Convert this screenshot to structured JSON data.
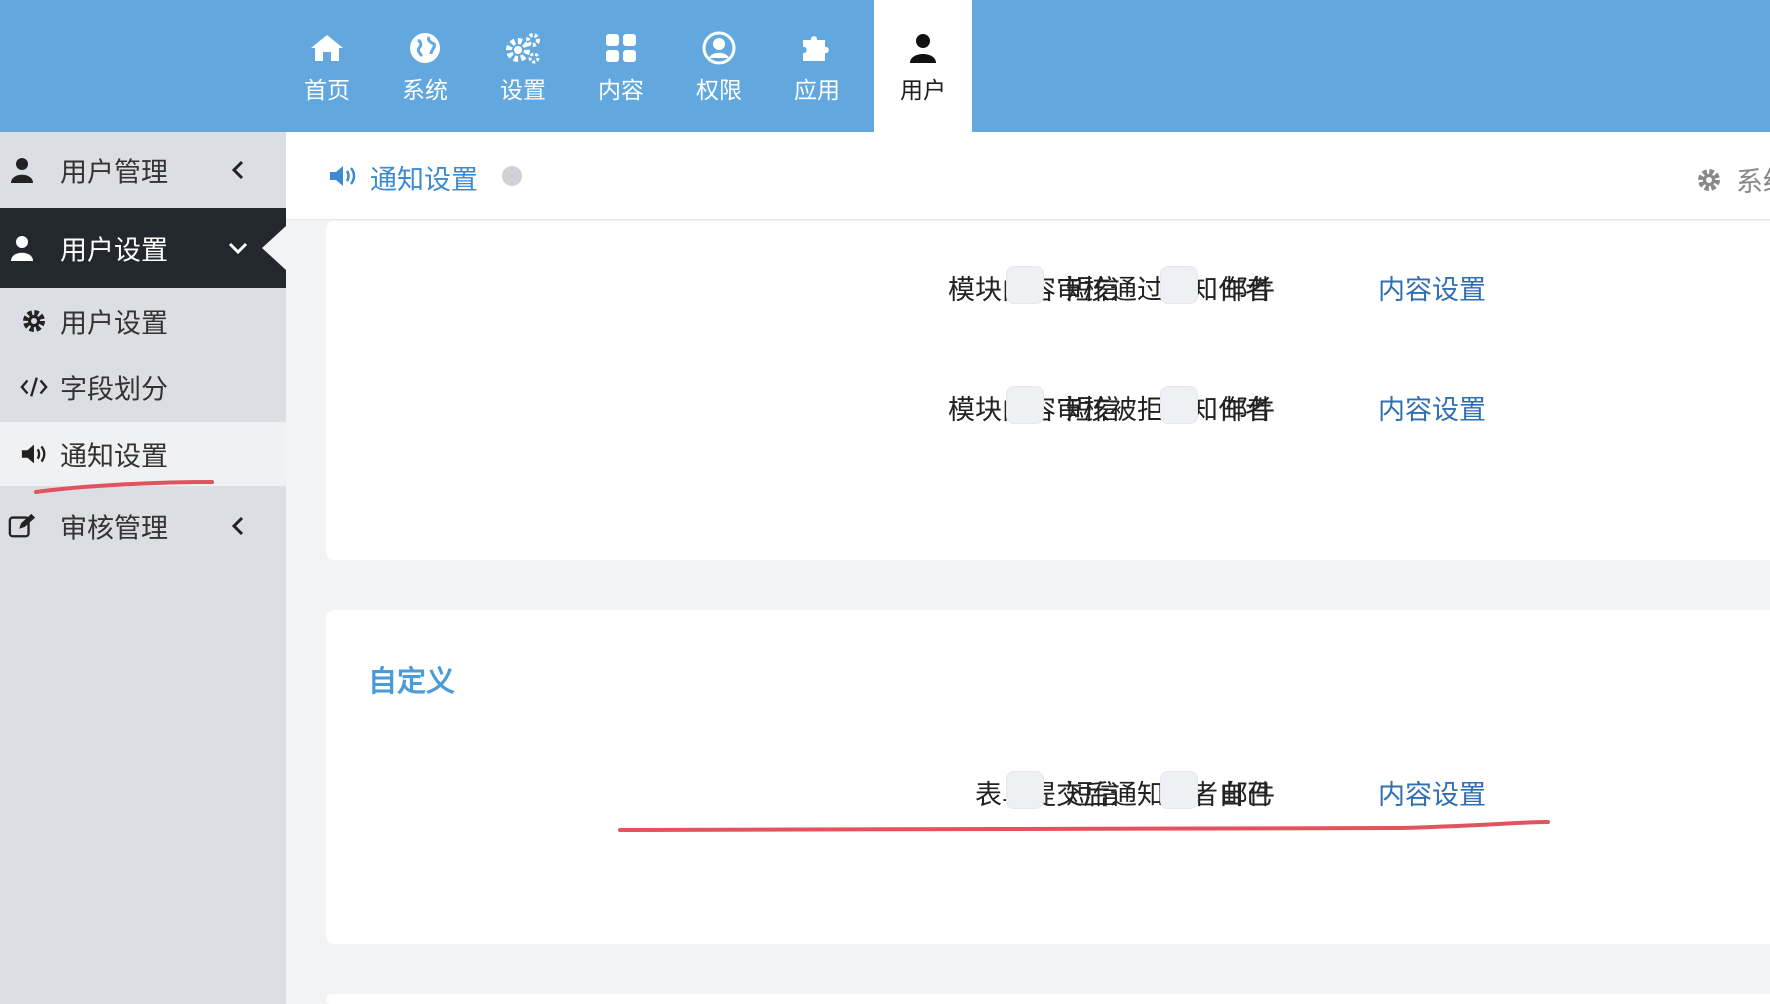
{
  "topnav": {
    "items": [
      {
        "label": "首页",
        "icon": "home-icon"
      },
      {
        "label": "系统",
        "icon": "globe-icon"
      },
      {
        "label": "设置",
        "icon": "gears-icon"
      },
      {
        "label": "内容",
        "icon": "grid-icon"
      },
      {
        "label": "权限",
        "icon": "user-circle-icon"
      },
      {
        "label": "应用",
        "icon": "puzzle-icon"
      },
      {
        "label": "用户",
        "icon": "user-icon"
      }
    ],
    "active": "用户"
  },
  "sidebar": {
    "items": [
      {
        "label": "用户管理",
        "icon": "user-icon"
      },
      {
        "label": "用户设置",
        "icon": "user-icon"
      },
      {
        "label": "用户设置",
        "icon": "gear-icon"
      },
      {
        "label": "字段划分",
        "icon": "code-icon"
      },
      {
        "label": "通知设置",
        "icon": "volume-icon"
      },
      {
        "label": "审核管理",
        "icon": "edit-icon"
      }
    ],
    "active": "通知设置"
  },
  "header": {
    "title": "通知设置",
    "right_label": "系统"
  },
  "rows_top": [
    {
      "label": "模块内容审核通过通知作者",
      "sms": "短信",
      "mail": "邮件",
      "link": "内容设置"
    },
    {
      "label": "模块内容审核被拒通知作者",
      "sms": "短信",
      "mail": "邮件",
      "link": "内容设置"
    }
  ],
  "custom_section": {
    "title": "自定义",
    "rows": [
      {
        "label": "表单提交后通知作者自己",
        "sms": "短信",
        "mail": "邮件",
        "link": "内容设置"
      }
    ]
  },
  "colors": {
    "topbar": "#62a8de",
    "sidebar": "#dcdee3",
    "sidebar_open": "#23272e",
    "link": "#2f6fb3",
    "annotation": "#e0535f"
  }
}
